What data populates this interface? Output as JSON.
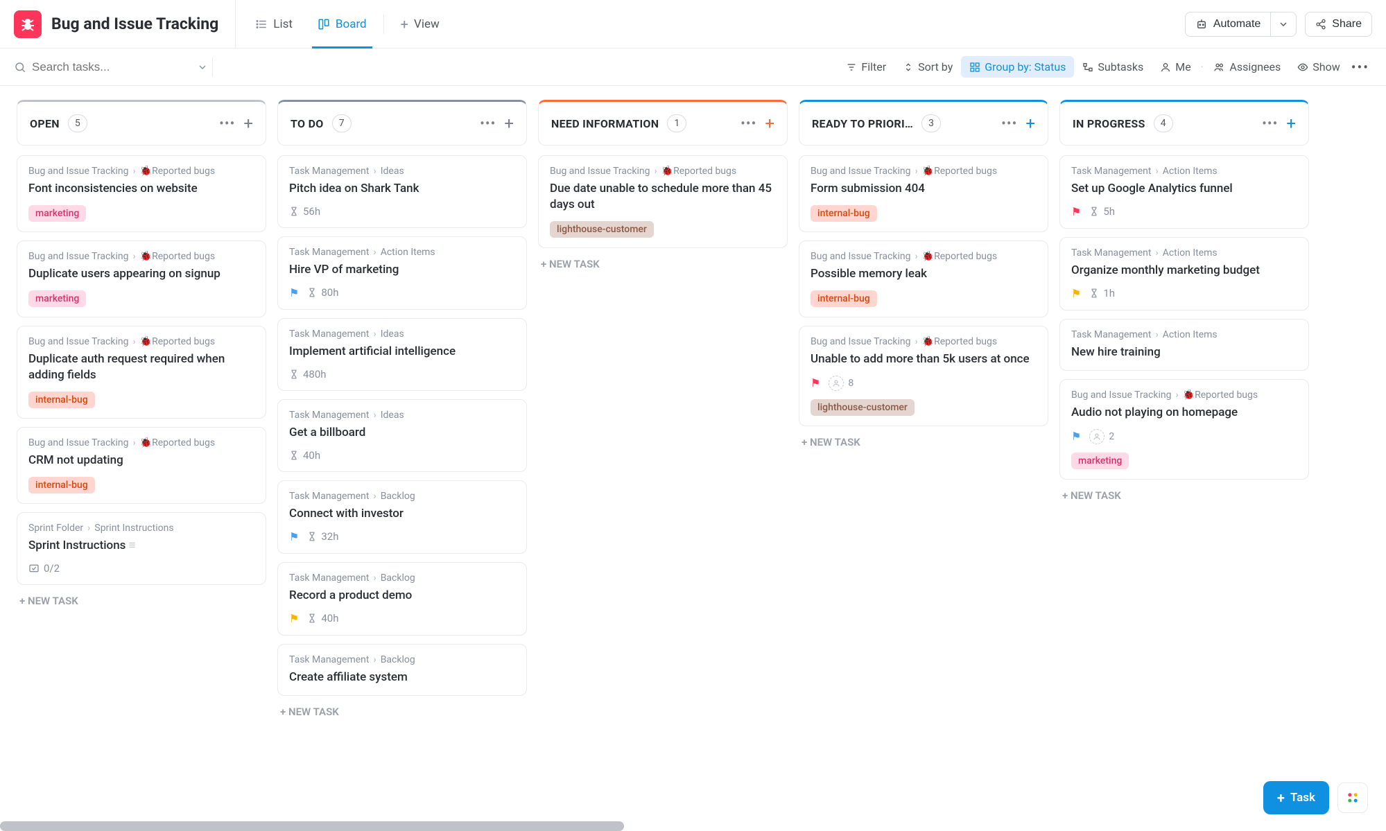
{
  "header": {
    "title": "Bug and Issue Tracking",
    "tabs": {
      "list": "List",
      "board": "Board",
      "view": "View"
    },
    "automate": "Automate",
    "share": "Share"
  },
  "toolbar": {
    "searchPlaceholder": "Search tasks...",
    "filter": "Filter",
    "sort": "Sort by",
    "group": "Group by: Status",
    "subtasks": "Subtasks",
    "me": "Me",
    "assignees": "Assignees",
    "show": "Show"
  },
  "newTaskLabel": "+ NEW TASK",
  "fab": {
    "task": "Task"
  },
  "breadcrumbs": {
    "bugTracking": "Bug and Issue Tracking",
    "reportedBugs": "Reported bugs",
    "taskMgmt": "Task Management",
    "ideas": "Ideas",
    "actionItems": "Action Items",
    "backlog": "Backlog",
    "sprintFolder": "Sprint Folder",
    "sprintInstr": "Sprint Instructions"
  },
  "tags": {
    "marketing": "marketing",
    "internalBug": "internal-bug",
    "lighthouse": "lighthouse-customer"
  },
  "columns": [
    {
      "title": "OPEN",
      "count": "5",
      "color": "#bfc3c9",
      "addColor": "#7c828d",
      "cards": [
        {
          "bcKey": "bugs",
          "title": "Font inconsistencies on website",
          "tags": [
            "marketing"
          ]
        },
        {
          "bcKey": "bugs",
          "title": "Duplicate users appearing on signup",
          "tags": [
            "marketing"
          ]
        },
        {
          "bcKey": "bugs",
          "title": "Duplicate auth request required when adding fields",
          "tags": [
            "internalBug"
          ]
        },
        {
          "bcKey": "bugs",
          "title": "CRM not updating",
          "tags": [
            "internalBug"
          ]
        },
        {
          "bcKey": "sprint",
          "title": "Sprint Instructions",
          "subtask": "0/2",
          "desc": true
        }
      ]
    },
    {
      "title": "TO DO",
      "count": "7",
      "color": "#87909e",
      "addColor": "#7c828d",
      "cards": [
        {
          "bcKey": "ideas",
          "title": "Pitch idea on Shark Tank",
          "time": "56h"
        },
        {
          "bcKey": "action",
          "title": "Hire VP of marketing",
          "flag": "blue",
          "time": "80h"
        },
        {
          "bcKey": "ideas",
          "title": "Implement artificial intelligence",
          "time": "480h"
        },
        {
          "bcKey": "ideas",
          "title": "Get a billboard",
          "time": "40h"
        },
        {
          "bcKey": "backlog",
          "title": "Connect with investor",
          "flag": "blue",
          "time": "32h"
        },
        {
          "bcKey": "backlog",
          "title": "Record a product demo",
          "flag": "yellow",
          "time": "40h"
        },
        {
          "bcKey": "backlog",
          "title": "Create affiliate system"
        }
      ]
    },
    {
      "title": "NEED INFORMATION",
      "count": "1",
      "color": "#fd6a3a",
      "addColor": "#fd6a3a",
      "cards": [
        {
          "bcKey": "bugs",
          "title": "Due date unable to schedule more than 45 days out",
          "tags": [
            "lighthouse"
          ]
        }
      ]
    },
    {
      "title": "READY TO PRIORI…",
      "count": "3",
      "color": "#1090e0",
      "addColor": "#1090e0",
      "cards": [
        {
          "bcKey": "bugs",
          "title": "Form submission 404",
          "tags": [
            "internalBug"
          ]
        },
        {
          "bcKey": "bugs",
          "title": "Possible memory leak",
          "tags": [
            "internalBug"
          ]
        },
        {
          "bcKey": "bugs",
          "title": "Unable to add more than 5k users at once",
          "flag": "red",
          "avatarCount": "8",
          "tags": [
            "lighthouse"
          ]
        }
      ]
    },
    {
      "title": "IN PROGRESS",
      "count": "4",
      "color": "#1090e0",
      "addColor": "#1090e0",
      "cards": [
        {
          "bcKey": "action",
          "title": "Set up Google Analytics funnel",
          "flag": "red",
          "time": "5h"
        },
        {
          "bcKey": "action",
          "title": "Organize monthly marketing budget",
          "flag": "yellow",
          "time": "1h"
        },
        {
          "bcKey": "action",
          "title": "New hire training"
        },
        {
          "bcKey": "bugs",
          "title": "Audio not playing on homepage",
          "flag": "blue",
          "avatarCount": "2",
          "tags": [
            "marketing"
          ]
        }
      ]
    }
  ]
}
